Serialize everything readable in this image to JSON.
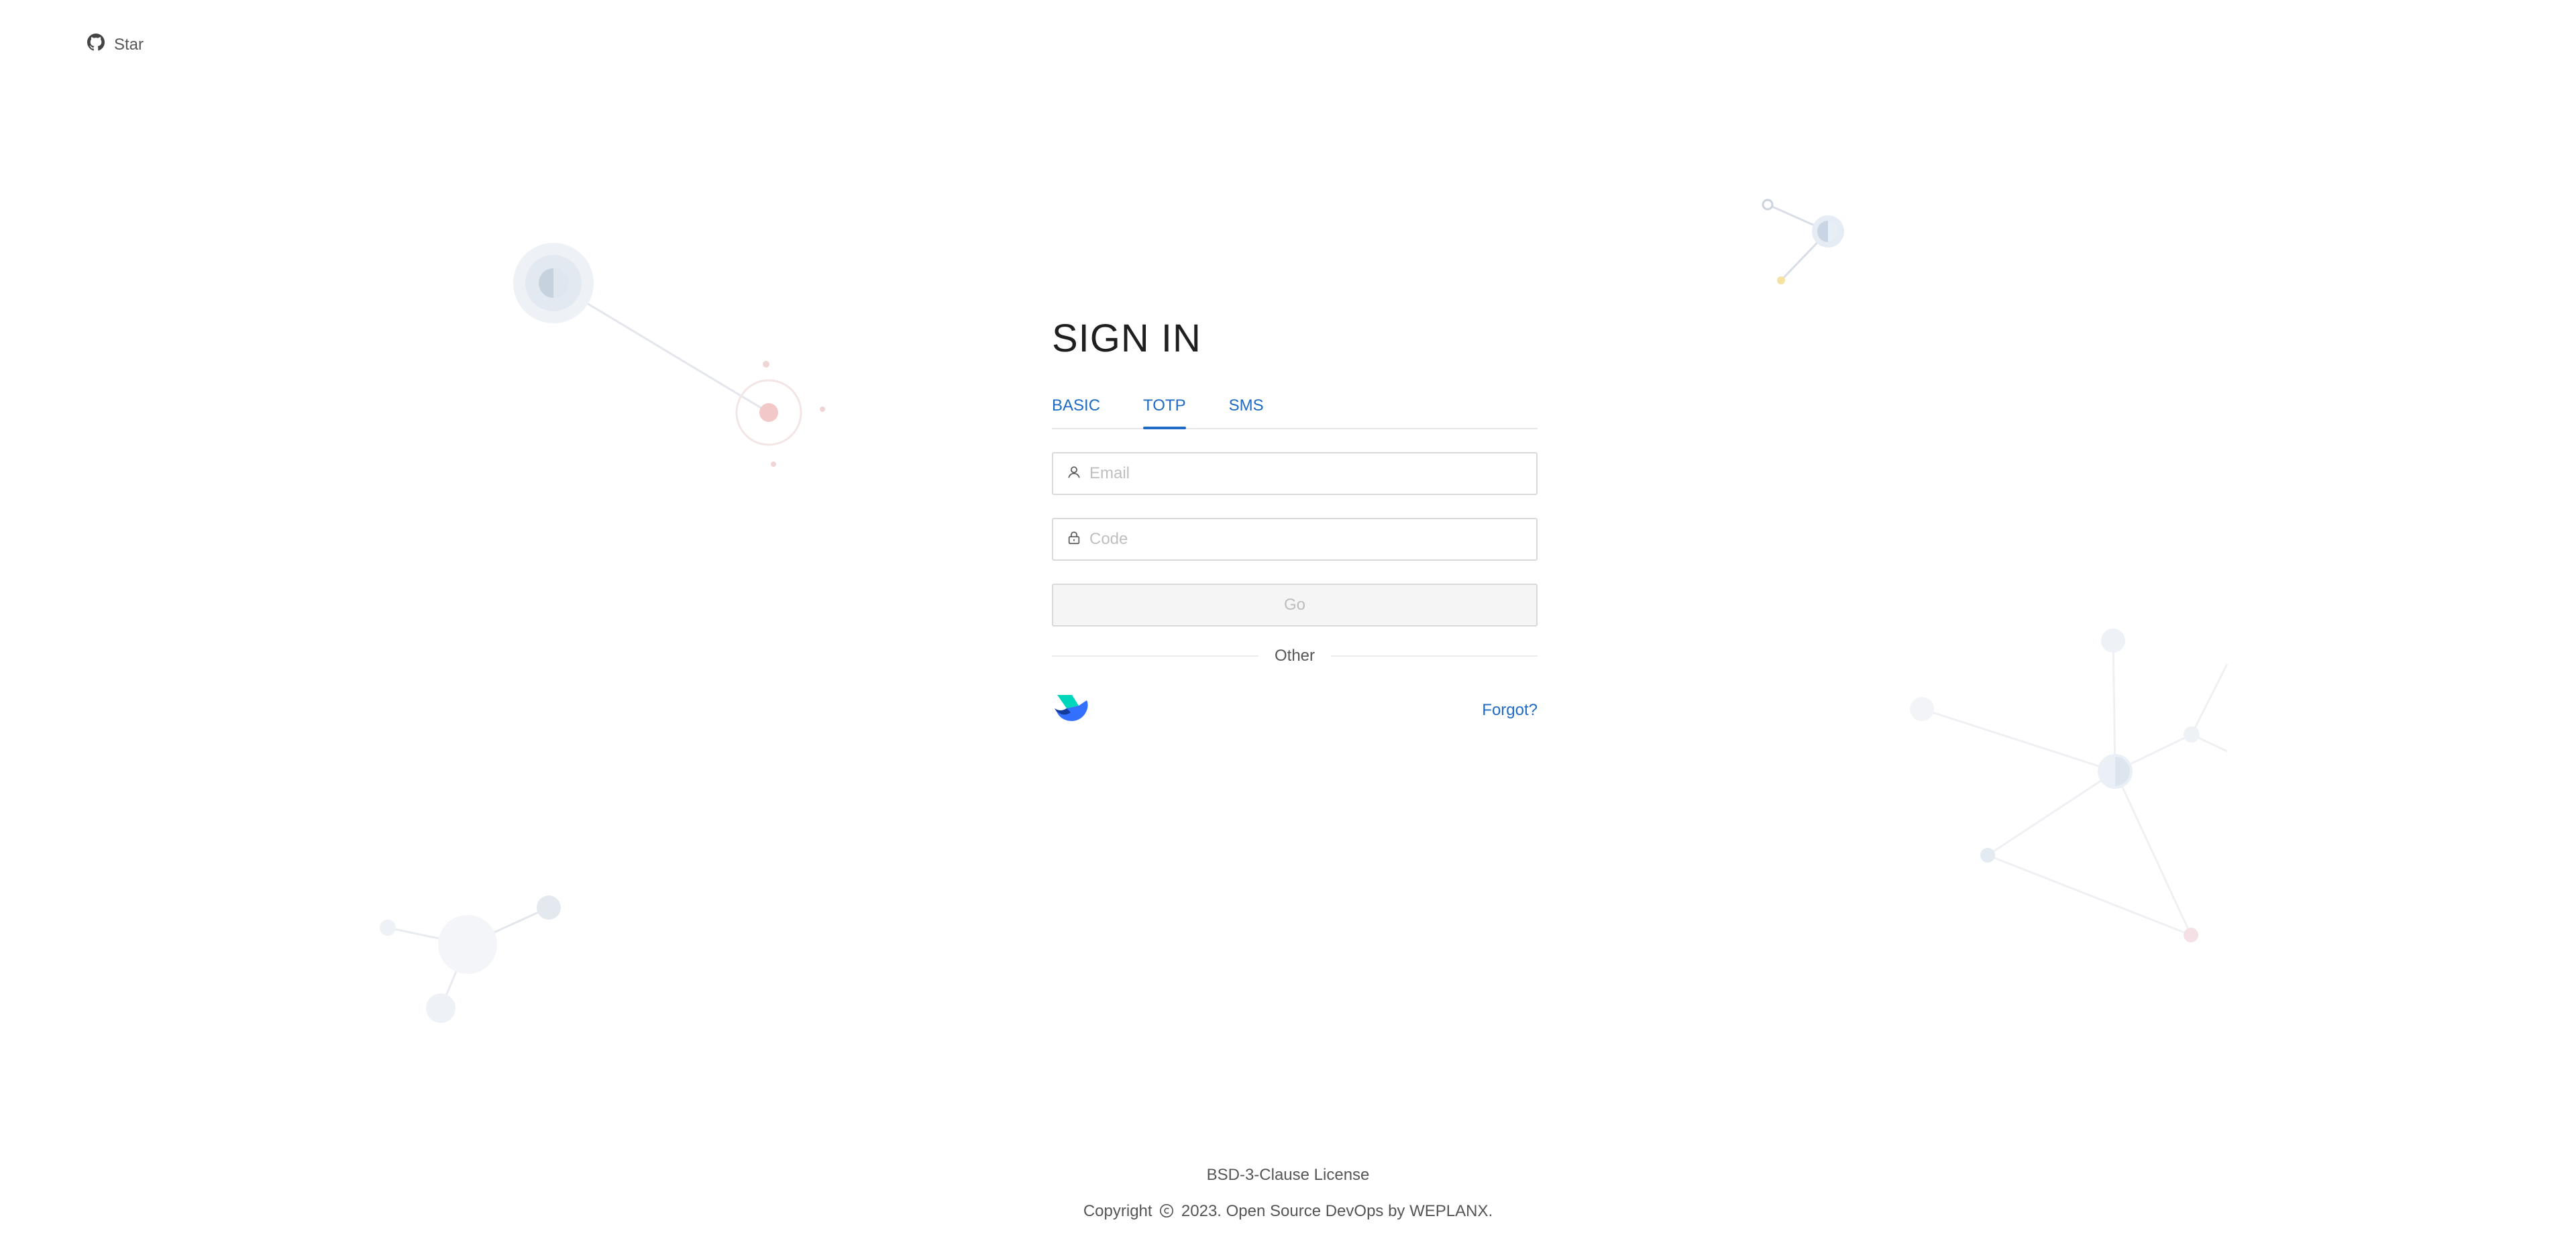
{
  "header": {
    "github_label": "Star",
    "github_icon": "github-icon"
  },
  "login": {
    "title": "SIGN IN",
    "tabs": [
      {
        "label": "BASIC",
        "active": false
      },
      {
        "label": "TOTP",
        "active": true
      },
      {
        "label": "SMS",
        "active": false
      }
    ],
    "email_placeholder": "Email",
    "email_value": "",
    "email_icon": "user-icon",
    "code_placeholder": "Code",
    "code_value": "",
    "code_icon": "lock-icon",
    "submit_label": "Go",
    "divider_label": "Other",
    "sso_icon": "feishu-logo-icon",
    "forgot_label": "Forgot?"
  },
  "footer": {
    "license": "BSD-3-Clause License",
    "copyright_prefix": "Copyright",
    "copyright_suffix": "2023. Open Source DevOps by WEPLANX."
  },
  "colors": {
    "accent": "#1e6ac5",
    "text": "#1f1f1f",
    "muted": "#555555",
    "border": "#d9d9d9"
  }
}
